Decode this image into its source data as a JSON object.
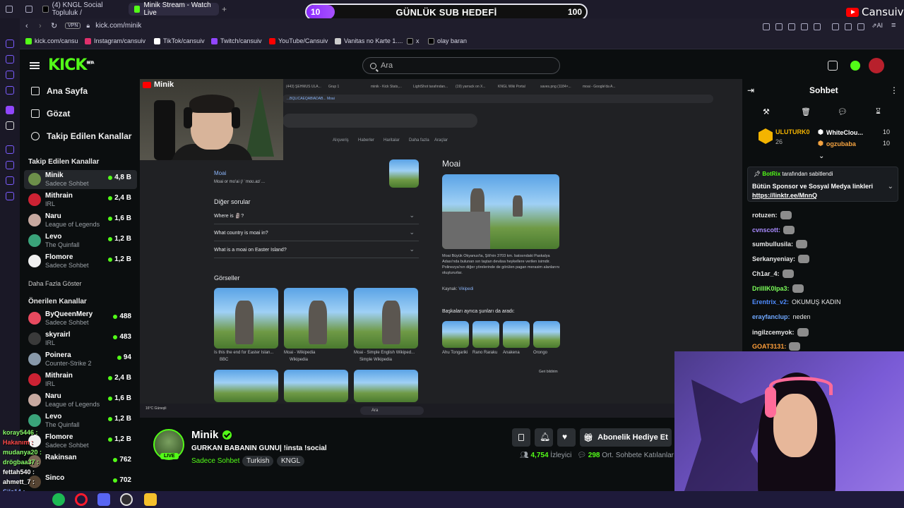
{
  "browser": {
    "tabs": [
      {
        "label": "(4) KNGL Social Topluluk /",
        "icon": "x-icon"
      },
      {
        "label": "Minik Stream - Watch Live",
        "icon": "kick-icon",
        "active": true
      }
    ],
    "vpn": "VPN",
    "url": "kick.com/minik",
    "bookmarks": [
      {
        "label": "kick.com/cansu",
        "color": "#53fc18"
      },
      {
        "label": "Instagram/cansuiv",
        "color": "#e1306c"
      },
      {
        "label": "TikTok/cansuiv",
        "color": "#ffffff"
      },
      {
        "label": "Twitch/cansuiv",
        "color": "#9146ff"
      },
      {
        "label": "YouTube/Cansuiv",
        "color": "#ff0000"
      },
      {
        "label": "Vanitas no Karte 1....",
        "color": "#cccccc"
      },
      {
        "label": "x",
        "color": "#ffffff"
      },
      {
        "label": "olay baran",
        "color": "#ffffff"
      }
    ]
  },
  "sub_goal": {
    "current": "10",
    "title": "GÜNLÜK SUB HEDEFİ",
    "target": "100",
    "progress_fraction": 0.1
  },
  "yt_brand": "Cansuiv",
  "kick": {
    "logo": "KICK",
    "logo_badge": "BETA",
    "search_placeholder": "Ara",
    "nav": [
      {
        "label": "Ana Sayfa",
        "icon": "home-icon"
      },
      {
        "label": "Gözat",
        "icon": "browse-icon"
      },
      {
        "label": "Takip Edilen Kanallar",
        "icon": "heart-icon"
      }
    ],
    "followed_title": "Takip Edilen Kanallar",
    "followed": [
      {
        "name": "Minik",
        "game": "Sadece Sohbet",
        "viewers": "4,8 B",
        "color": "#6d8f4a"
      },
      {
        "name": "Mithrain",
        "game": "IRL",
        "viewers": "2,4 B",
        "color": "#cc2233"
      },
      {
        "name": "Naru",
        "game": "League of Legends",
        "viewers": "1,6 B",
        "color": "#c7a9a0"
      },
      {
        "name": "Levo",
        "game": "The Quinfall",
        "viewers": "1,2 B",
        "color": "#3aa37a"
      },
      {
        "name": "Flomore",
        "game": "Sadece Sohbet",
        "viewers": "1,2 B",
        "color": "#f0f0f0"
      }
    ],
    "more_label": "Daha Fazla Göster",
    "recommended_title": "Önerilen Kanallar",
    "recommended": [
      {
        "name": "ByQueenMery",
        "game": "Sadece Sohbet",
        "viewers": "488",
        "color": "#e84a5f"
      },
      {
        "name": "skyrairl",
        "game": "IRL",
        "viewers": "483",
        "color": "#3a3a3a"
      },
      {
        "name": "Poinera",
        "game": "Counter-Strike 2",
        "viewers": "94",
        "color": "#8899aa"
      },
      {
        "name": "Mithrain",
        "game": "IRL",
        "viewers": "2,4 B",
        "color": "#cc2233"
      },
      {
        "name": "Naru",
        "game": "League of Legends",
        "viewers": "1,6 B",
        "color": "#c7a9a0"
      },
      {
        "name": "Levo",
        "game": "The Quinfall",
        "viewers": "1,2 B",
        "color": "#3aa37a"
      },
      {
        "name": "Flomore",
        "game": "Sadece Sohbet",
        "viewers": "1,2 B",
        "color": "#f0f0f0"
      },
      {
        "name": "Rakinsan",
        "game": "",
        "viewers": "762",
        "color": "#7a6655"
      },
      {
        "name": "Sinco",
        "game": "",
        "viewers": "702",
        "color": "#554433"
      }
    ]
  },
  "stream_overlay": {
    "yt_tag": "Minik",
    "google_tabs": [
      "(443) ŞEHMUS ULA...",
      "Grup 1",
      "minik - Kick Stats,...",
      "LightShot tarafından...",
      "(19) yarrack on X...",
      "KNGL Wiki Portal",
      "saves.png (1184×...",
      "moai - Google'da A..."
    ],
    "google_url": "...BQLICAEQABIADAB... Moai",
    "google_nav": [
      "Alışveriş",
      "Haberler",
      "Haritalar",
      "Daha fazla",
      "Araçlar"
    ],
    "result_link": "Moai",
    "result_sub": "Moai or mo'ai (/ ˈmoʊ.aɪ/ ...",
    "related_title": "Diğer sorular",
    "questions": [
      "Where is 🗿?",
      "What country is moai in?",
      "What is a moai on Easter Island?"
    ],
    "images_title": "Görseller",
    "image_captions": [
      "Is this the end for Easter Islan...",
      "Moai - Wikipedia",
      "Moai - Simple English Wikiped..."
    ],
    "image_sources": [
      "BBC",
      "Wikipedia",
      "Simple Wikipedia"
    ],
    "panel_title": "Moai",
    "panel_desc": "Moai Büyük Okyanus'ta, Şili'nin 3703 km. batısındaki Paskalya Adası'nda bulunan sın taştan devâsa heykellere verilen isimdir. Polinezya'nın diğer yörelerinde de görülen pagan merasim alanlarını oluştururlar.",
    "panel_source_label": "Kaynak:",
    "panel_source": "Vikipedi",
    "also_search": "Başkaları ayrıca şunları da aradı:",
    "also_items": [
      "Ahu Tongariki",
      "Rano Raraku",
      "Anakena",
      "Orongo"
    ],
    "feedback": "Geri bildirim",
    "taskbar_search": "Ara",
    "weather": "16°C Güneşli"
  },
  "stream_info": {
    "channel": "Minik",
    "title": "GURKAN BABANIN GUNU| !insta !social",
    "category": "Sadece Sohbet",
    "tags": [
      "Turkish",
      "KNGL"
    ],
    "live_label": "LIVE",
    "subscribe_label": "Abonelik Hediye Et",
    "viewers": "4,754",
    "viewers_label": "İzleyici",
    "chatters": "298",
    "chatters_label": "Ort. Sohbete Katılanlar"
  },
  "chat": {
    "title": "Sohbet",
    "top_gifters": [
      {
        "name": "ULUTURK0",
        "count": "26",
        "color": "#f4b400"
      },
      {
        "name": "WhiteClou...",
        "count": "10",
        "color": "#ffffff"
      },
      {
        "name": "ogzubaba",
        "count": "10",
        "color": "#f4a340"
      }
    ],
    "pinned_by": "BotRix",
    "pinned_suffix": "tarafından sabitlendi",
    "pinned_text": "Bütün Sponsor ve Sosyal Medya linkleri",
    "pinned_link": "https://linktr.ee/MnnQ",
    "messages": [
      {
        "user": "rotuzen:",
        "text": "",
        "color": "#e8e8e8"
      },
      {
        "user": "cvnscott:",
        "text": "",
        "color": "#a98bff"
      },
      {
        "user": "sumbullusila:",
        "text": "",
        "color": "#e8e8e8"
      },
      {
        "user": "Serkanyeniay:",
        "text": "",
        "color": "#e8e8e8"
      },
      {
        "user": "Ch1ar_4:",
        "text": "",
        "color": "#e8e8e8"
      },
      {
        "user": "DrillIK0lpa3:",
        "text": "",
        "color": "#7cff5a"
      },
      {
        "user": "Erentrix_v2:",
        "text": "OKUMUŞ KADIN",
        "color": "#4f8cff"
      },
      {
        "user": "erayfanclup:",
        "text": "neden",
        "color": "#6fa8ff"
      },
      {
        "user": "ingilzcemyok:",
        "text": "",
        "color": "#e8e8e8"
      },
      {
        "user": "GOAT3131:",
        "text": "",
        "color": "#ff9f3a"
      }
    ]
  },
  "overlay_chat": [
    {
      "user": "koray5446 :",
      "color": "#8aff6a"
    },
    {
      "user": "Hakanım :",
      "color": "#ff4a4a"
    },
    {
      "user": "mudanya20 :",
      "color": "#8aff6a"
    },
    {
      "user": "drögbaa37 :",
      "color": "#8aff6a"
    },
    {
      "user": "fettah540 :",
      "color": "#ffffff"
    },
    {
      "user": "ahmett_7 :",
      "color": "#ffffff"
    },
    {
      "user": "Sila14 :",
      "color": "#8aa0ff"
    }
  ],
  "taskbar_icons": [
    "spotify-icon",
    "opera-icon",
    "discord-icon",
    "obs-icon",
    "folder-icon"
  ]
}
